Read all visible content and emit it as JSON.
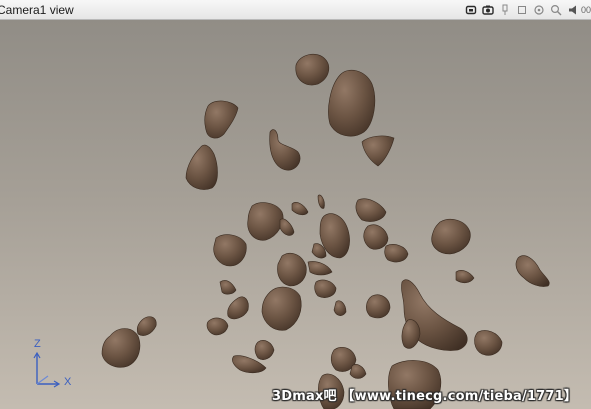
{
  "window": {
    "title": "Camera1 view",
    "zoom_label": "00"
  },
  "toolbar": {
    "icons": [
      "camera-render-icon",
      "camera-snapshot-icon",
      "pin-icon",
      "square-icon",
      "settings-icon",
      "zoom-icon",
      "speaker-icon"
    ]
  },
  "viewport": {
    "background_top": "#918d86",
    "background_bottom": "#c4bcb1",
    "rock_color": "#6b5443",
    "rock_shadow": "#3f2f24",
    "rock_highlight": "#927865"
  },
  "axis_gizmo": {
    "z_label": "Z",
    "x_label": "X",
    "color": "#3a5fc0"
  },
  "watermark": {
    "text": "3Dmax吧 【www.tinecg.com/tieba/1771】"
  }
}
